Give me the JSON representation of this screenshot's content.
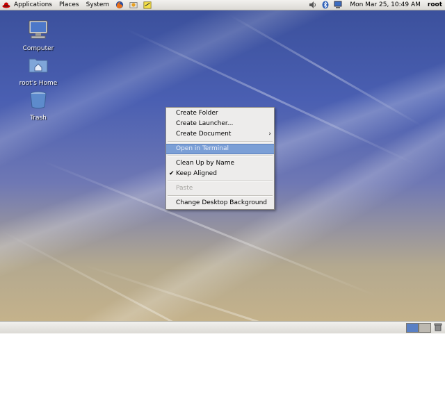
{
  "top_panel": {
    "menus": [
      "Applications",
      "Places",
      "System"
    ],
    "clock": "Mon Mar 25, 10:49 AM",
    "user": "root"
  },
  "desktop_icons": [
    {
      "label": "Computer",
      "icon": "computer-icon"
    },
    {
      "label": "root's Home",
      "icon": "home-folder-icon"
    },
    {
      "label": "Trash",
      "icon": "trash-icon"
    }
  ],
  "context_menu": {
    "items": [
      {
        "label": "Create Folder",
        "state": "normal"
      },
      {
        "label": "Create Launcher...",
        "state": "normal"
      },
      {
        "label": "Create Document",
        "state": "normal",
        "submenu": true
      },
      {
        "label": "Open in Terminal",
        "state": "highlighted"
      },
      {
        "label": "Clean Up by Name",
        "state": "normal"
      },
      {
        "label": "Keep Aligned",
        "state": "checked"
      },
      {
        "label": "Paste",
        "state": "disabled"
      },
      {
        "label": "Change Desktop Background",
        "state": "normal"
      }
    ],
    "submenu_arrow": "›",
    "check_mark": "✔"
  },
  "colors": {
    "menu_highlight": "#7b9fd6",
    "panel": "#e8e6e2",
    "wallpaper_top": "#3a4f9a",
    "wallpaper_bottom": "#c8b48a"
  }
}
